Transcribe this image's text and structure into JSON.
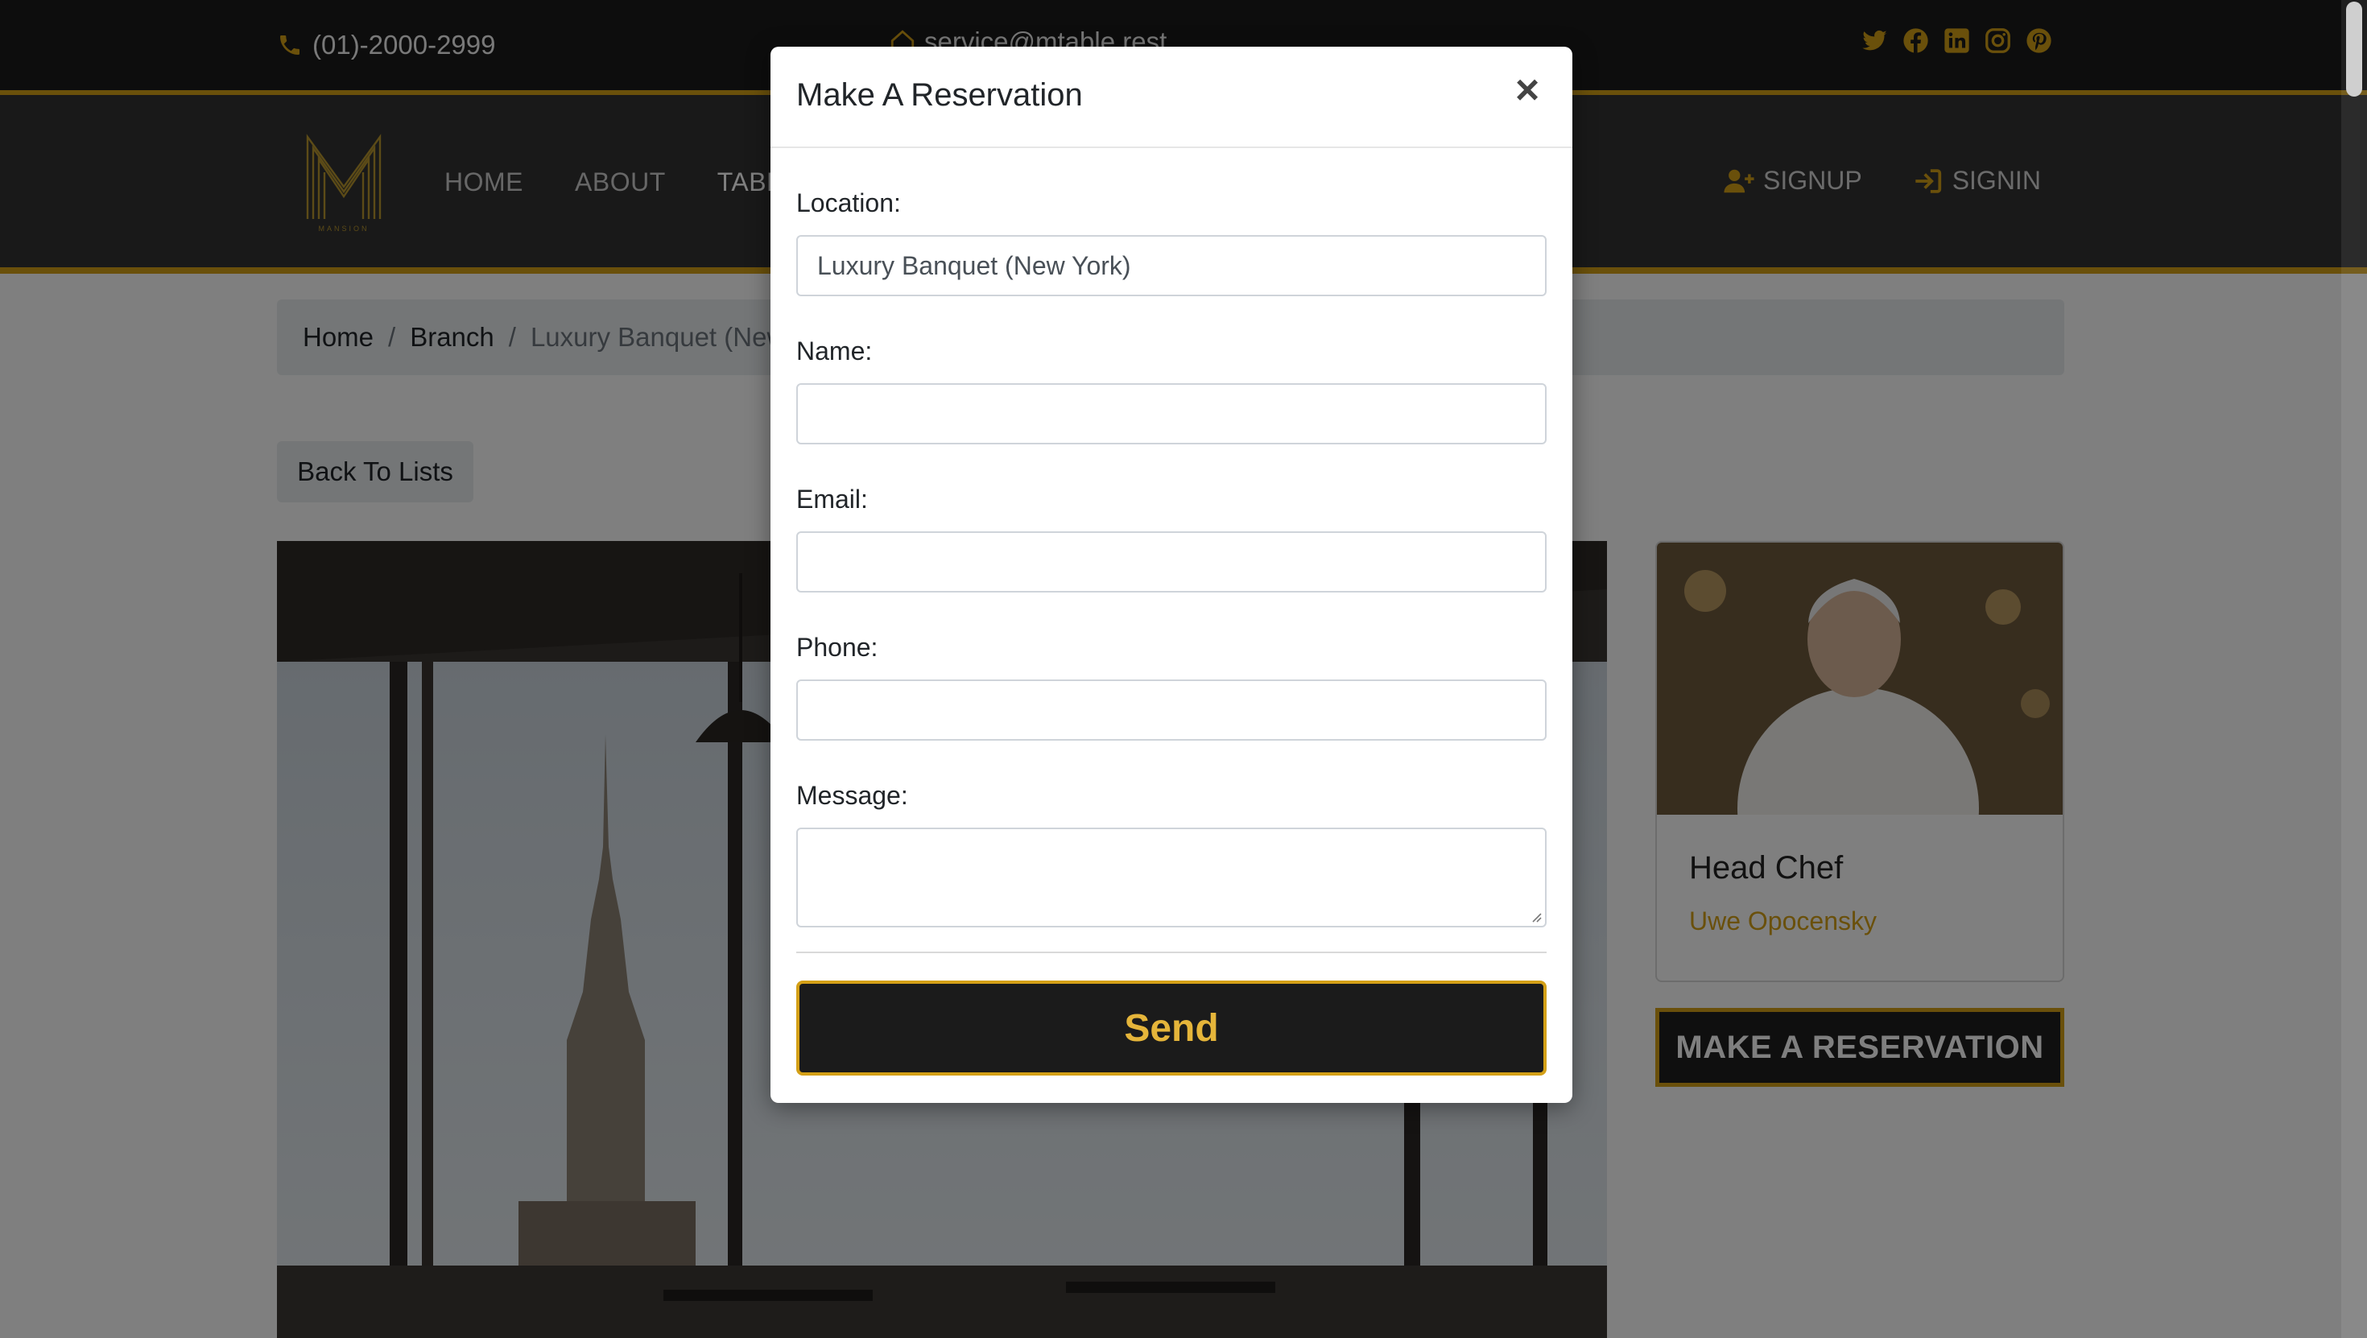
{
  "topbar": {
    "phone": "(01)-2000-2999",
    "email": "service@mtable.rest",
    "phone_icon": "phone-icon",
    "email_icon": "home-icon",
    "socials": [
      "twitter-icon",
      "facebook-icon",
      "linkedin-icon",
      "instagram-icon",
      "pinterest-icon"
    ]
  },
  "brand": {
    "logo_letter": "M",
    "logo_word": "MANSION"
  },
  "nav": {
    "items": [
      {
        "label": "HOME"
      },
      {
        "label": "ABOUT"
      },
      {
        "label": "TABLE"
      }
    ],
    "signup": "SIGNUP",
    "signin": "SIGNIN"
  },
  "breadcrumb": {
    "home": "Home",
    "branch": "Branch",
    "current": "Luxury Banquet  (New York)"
  },
  "page": {
    "back_button": "Back To Lists",
    "chef_title": "Head Chef",
    "chef_name": "Uwe Opocensky",
    "reserve_button": "MAKE A RESERVATION"
  },
  "modal": {
    "title": "Make A Reservation",
    "close": "×",
    "location_label": "Location:",
    "location_value": "Luxury Banquet  (New York)",
    "name_label": "Name:",
    "email_label": "Email:",
    "phone_label": "Phone:",
    "message_label": "Message:",
    "send_button": "Send"
  },
  "colors": {
    "accent": "#d4a017",
    "dark": "#1b1b1b",
    "nav_bg": "#333333"
  }
}
